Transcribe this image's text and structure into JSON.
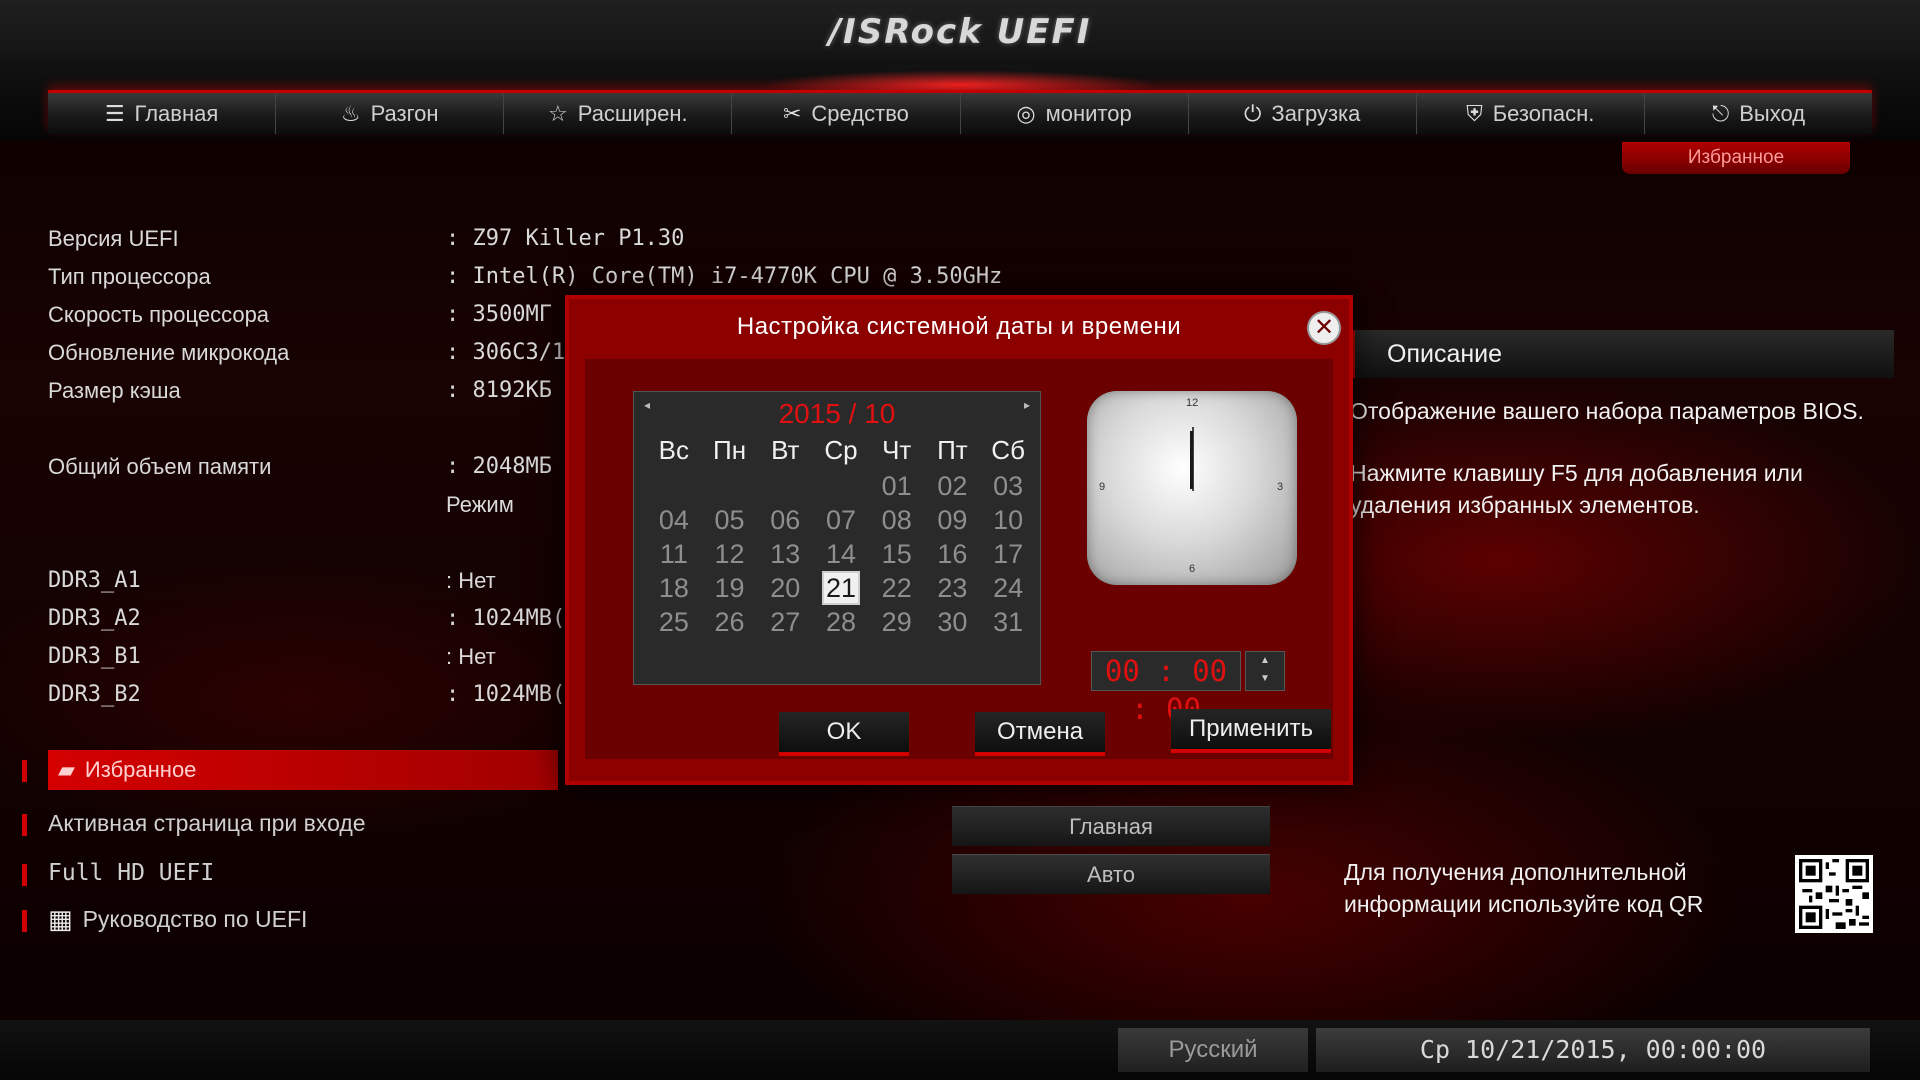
{
  "header": {
    "logo": "/ISRock UEFI",
    "nav": [
      {
        "label": "Главная",
        "icon": "list-icon"
      },
      {
        "label": "Разгон",
        "icon": "flame-icon"
      },
      {
        "label": "Расширен.",
        "icon": "star-icon"
      },
      {
        "label": "Средство",
        "icon": "tools-icon"
      },
      {
        "label": "монитор",
        "icon": "monitor-icon"
      },
      {
        "label": "Загрузка",
        "icon": "power-icon"
      },
      {
        "label": "Безопасн.",
        "icon": "shield-icon"
      },
      {
        "label": "Выход",
        "icon": "exit-icon"
      }
    ],
    "favorites_tab": "Избранное"
  },
  "info": {
    "rows": [
      {
        "label": "Версия UEFI",
        "value": "Z97 Killer P1.30"
      },
      {
        "label": "Тип процессора",
        "value": "Intel(R) Core(TM) i7-4770K CPU @ 3.50GHz"
      },
      {
        "label": "Скорость процессора",
        "value": "3500МГ"
      },
      {
        "label": "Обновление микрокода",
        "value": "306C3/1"
      },
      {
        "label": "Размер кэша",
        "value": "8192КБ"
      },
      {
        "label": "Общий объем памяти",
        "value": "2048МБ"
      },
      {
        "label": "",
        "value": "Режим"
      },
      {
        "label": "DDR3_A1",
        "value": "Нет"
      },
      {
        "label": "DDR3_A2",
        "value": "1024MB("
      },
      {
        "label": "DDR3_B1",
        "value": "Нет"
      },
      {
        "label": "DDR3_B2",
        "value": "1024MB("
      }
    ]
  },
  "menu": {
    "favorites": "Избранное",
    "active_page": "Активная страница при входе",
    "full_hd": "Full HD UEFI",
    "guide": "Руководство по UEFI",
    "active_page_value": "Главная",
    "full_hd_value": "Авто"
  },
  "description": {
    "title": "Описание",
    "p1": "Отображение вашего набора параметров BIOS.",
    "p2": "Нажмите клавишу F5 для добавления или удаления избранных элементов.",
    "qr_text": "Для получения дополнительной информации используйте код QR"
  },
  "status": {
    "language": "Русский",
    "datetime": "Ср 10/21/2015, 00:00:00"
  },
  "dialog": {
    "title": "Настройка системной даты и времени",
    "close": "✕",
    "month": "2015 / 10",
    "weekdays": [
      "Вс",
      "Пн",
      "Вт",
      "Ср",
      "Чт",
      "Пт",
      "Сб"
    ],
    "days": [
      "",
      "",
      "",
      "",
      "01",
      "02",
      "03",
      "04",
      "05",
      "06",
      "07",
      "08",
      "09",
      "10",
      "11",
      "12",
      "13",
      "14",
      "15",
      "16",
      "17",
      "18",
      "19",
      "20",
      "21",
      "22",
      "23",
      "24",
      "25",
      "26",
      "27",
      "28",
      "29",
      "30",
      "31"
    ],
    "selected_day": "21",
    "clock_numbers": {
      "n12": "12",
      "n3": "3",
      "n6": "6",
      "n9": "9"
    },
    "time": "00 : 00 : 00",
    "spin_up": "▲",
    "spin_down": "▼",
    "ok": "OK",
    "cancel": "Отмена",
    "apply": "Применить",
    "prev": "◂",
    "next": "▸"
  }
}
